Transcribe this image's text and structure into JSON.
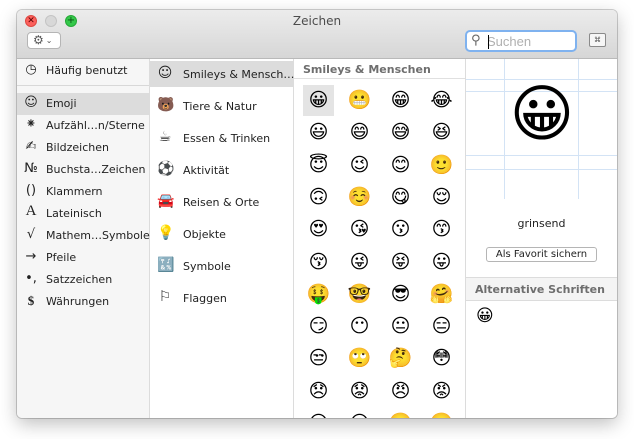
{
  "window": {
    "title": "Zeichen",
    "close_glyph": "✕",
    "zoom_glyph": "+"
  },
  "toolbar": {
    "gear_icon": "⚙",
    "gear_chevron": "⌄",
    "search_placeholder": "Suchen",
    "search_value": "",
    "search_icon": "⚲",
    "keyboard_viewer_icon": "⌘"
  },
  "sidebar": {
    "items": [
      {
        "icon": "◷",
        "label": "Häufig benutzt"
      },
      {
        "icon": "☺",
        "label": "Emoji"
      },
      {
        "icon": "⁕",
        "label": "Aufzähl…n/Sterne"
      },
      {
        "icon": "✍",
        "label": "Bildzeichen"
      },
      {
        "icon": "№",
        "label": "Buchsta…Zeichen"
      },
      {
        "icon": "()",
        "label": "Klammern"
      },
      {
        "icon": "A",
        "label": "Lateinisch"
      },
      {
        "icon": "√",
        "label": "Mathem…Symbole"
      },
      {
        "icon": "→",
        "label": "Pfeile"
      },
      {
        "icon": "•,",
        "label": "Satzzeichen"
      },
      {
        "icon": "$",
        "label": "Währungen"
      }
    ]
  },
  "categories": {
    "items": [
      {
        "icon": "☺",
        "label": "Smileys & Mensch…"
      },
      {
        "icon": "🐻",
        "label": "Tiere & Natur"
      },
      {
        "icon": "☕",
        "label": "Essen & Trinken"
      },
      {
        "icon": "⚽",
        "label": "Aktivität"
      },
      {
        "icon": "🚘",
        "label": "Reisen & Orte"
      },
      {
        "icon": "💡",
        "label": "Objekte"
      },
      {
        "icon": "🔣",
        "label": "Symbole"
      },
      {
        "icon": "⚐",
        "label": "Flaggen"
      }
    ]
  },
  "emoji_grid": {
    "header": "Smileys & Menschen",
    "rows": [
      [
        "😀",
        "😬",
        "😁",
        "😂"
      ],
      [
        "😃",
        "😄",
        "😅",
        "😆"
      ],
      [
        "😇",
        "😉",
        "😊",
        "🙂"
      ],
      [
        "🙃",
        "☺️",
        "😋",
        "😌"
      ],
      [
        "😍",
        "😘",
        "😗",
        "😙"
      ],
      [
        "😚",
        "😜",
        "😝",
        "😛"
      ],
      [
        "🤑",
        "🤓",
        "😎",
        "🤗"
      ],
      [
        "😏",
        "😶",
        "😐",
        "😑"
      ],
      [
        "😒",
        "🙄",
        "🤔",
        "😳"
      ],
      [
        "😞",
        "😟",
        "😠",
        "😡"
      ],
      [
        "😔",
        "😕",
        "🙁",
        "☹️"
      ]
    ]
  },
  "detail": {
    "preview_emoji": "😀",
    "name": "grinsend",
    "favorite_button": "Als Favorit sichern",
    "alt_header": "Alternative Schriften",
    "alt_glyph": "😀"
  }
}
